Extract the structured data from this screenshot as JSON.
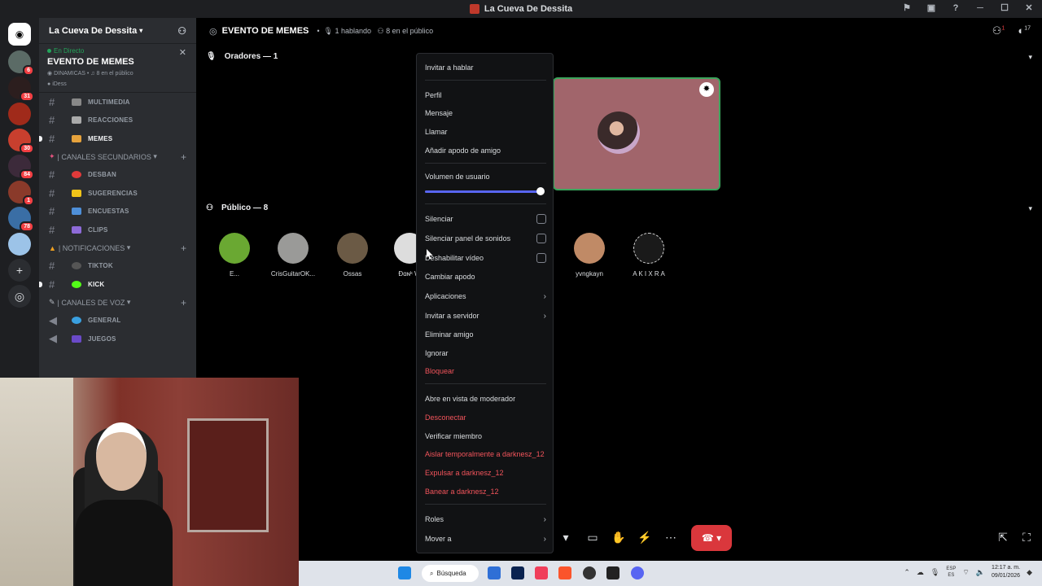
{
  "window": {
    "title": "La Cueva De Dessita"
  },
  "server": {
    "name": "La Cueva De Dessita",
    "badges": [
      "6",
      "31",
      "30",
      "84",
      "1",
      "78"
    ]
  },
  "event": {
    "status": "En Directo",
    "title": "EVENTO DE MEMES",
    "speakers_label": "DINAMICAS",
    "audience_label": "8 en el público",
    "host": "iDess"
  },
  "channels": [
    {
      "name": "MULTIMEDIA"
    },
    {
      "name": "REACCIONES"
    },
    {
      "name": "MEMES"
    }
  ],
  "categories": {
    "secondary": "| CANALES SECUNDARIOS",
    "notifications": "| NOTIFICACIONES",
    "voice": "| CANALES DE VOZ"
  },
  "secondary_channels": [
    {
      "name": "DESBAN"
    },
    {
      "name": "SUGERENCIAS"
    },
    {
      "name": "ENCUESTAS"
    },
    {
      "name": "CLIPS"
    }
  ],
  "notification_channels": [
    {
      "name": "TIKTOK"
    },
    {
      "name": "KICK"
    }
  ],
  "voice_channels": [
    {
      "name": "GENERAL"
    },
    {
      "name": "JUEGOS"
    }
  ],
  "stage": {
    "title": "EVENTO DE MEMES",
    "speaking": "1 hablando",
    "audience": "8 en el público",
    "speakers_header": "Oradores — 1",
    "audience_header": "Público — 8",
    "top_badge": "1",
    "avatar_badge": "17"
  },
  "audience": [
    {
      "name": "E..."
    },
    {
      "name": "CrisGuitarOK..."
    },
    {
      "name": "Ossas"
    },
    {
      "name": "Đɑɴᵏ W"
    },
    {
      "name": "yvngkayn"
    },
    {
      "name": "A K I X R A"
    }
  ],
  "menu": {
    "invite_to_speak": "Invitar a hablar",
    "profile": "Perfil",
    "message": "Mensaje",
    "call": "Llamar",
    "add_nickname": "Añadir apodo de amigo",
    "volume_label": "Volumen de usuario",
    "volume_fraction": 0.98,
    "mute": "Silenciar",
    "mute_soundboard": "Silenciar panel de sonidos",
    "disable_video": "Deshabilitar vídeo",
    "change_nickname": "Cambiar apodo",
    "apps": "Aplicaciones",
    "invite_server": "Invitar a servidor",
    "remove_friend": "Eliminar amigo",
    "ignore": "Ignorar",
    "block": "Bloquear",
    "mod_view": "Abre en vista de moderador",
    "disconnect": "Desconectar",
    "verify": "Verificar miembro",
    "timeout": "Aislar temporalmente a darknesz_12",
    "kick": "Expulsar a darknesz_12",
    "ban": "Banear a darknesz_12",
    "roles": "Roles",
    "move": "Mover a"
  },
  "taskbar": {
    "search": "Búsqueda",
    "lang1": "ESP",
    "lang2": "ES",
    "time": "12:17 a. m.",
    "date": "09/01/2026"
  },
  "colors": {
    "accent": "#5865f2",
    "danger": "#f2545b",
    "live": "#23a55a",
    "hangup": "#da373c"
  }
}
